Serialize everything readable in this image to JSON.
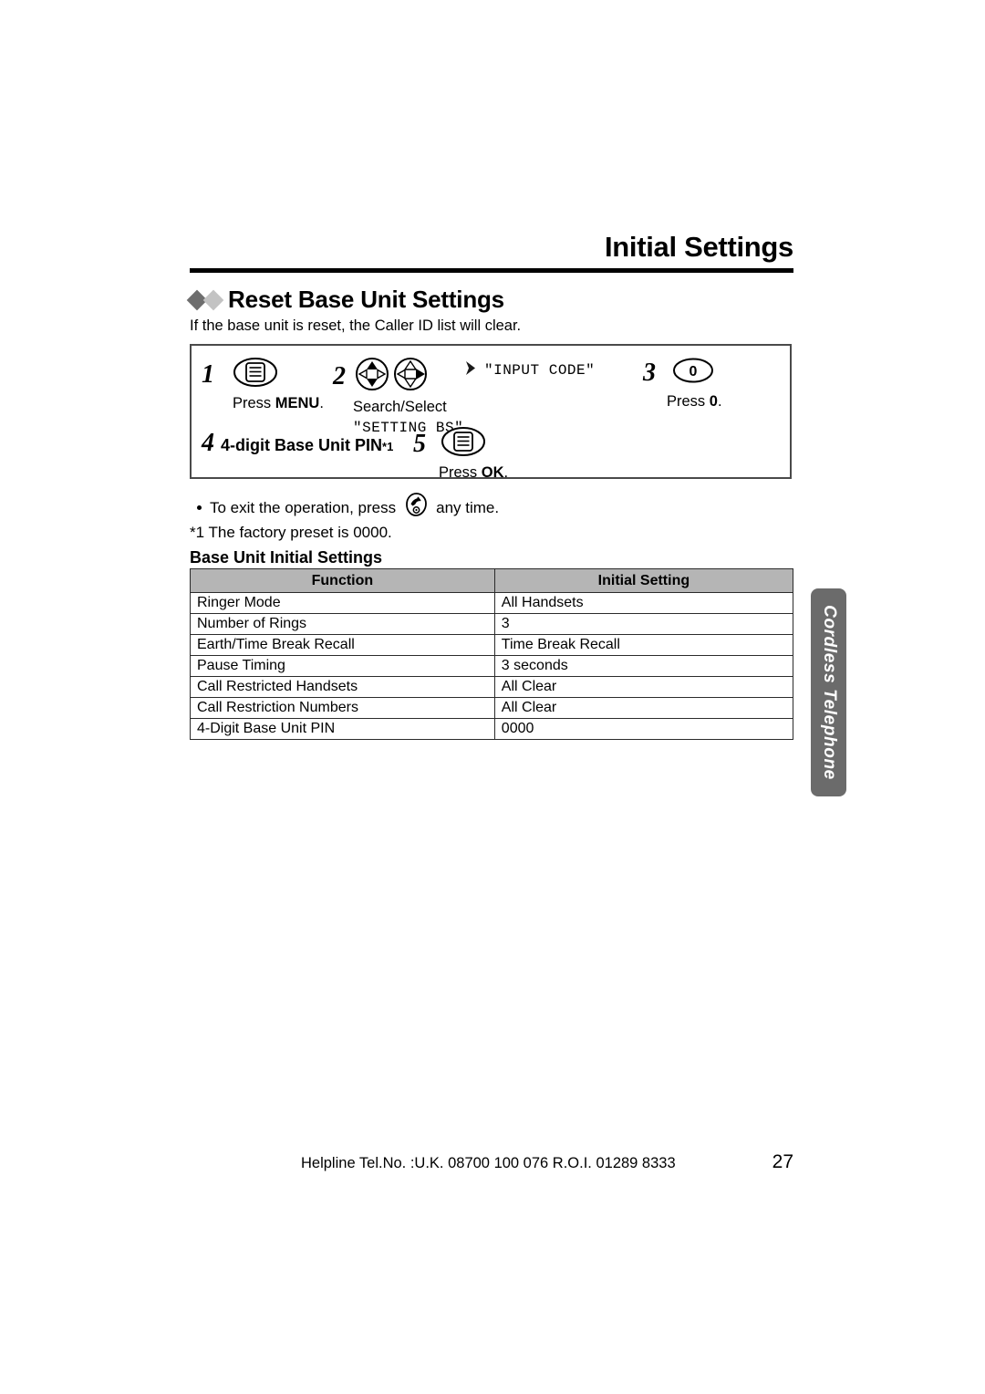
{
  "header": {
    "chapter_title": "Initial Settings"
  },
  "section": {
    "heading": "Reset Base Unit Settings",
    "intro": "If the base unit is reset, the Caller ID list will clear.",
    "bullet_dark_color": "#6e6e6e",
    "bullet_light_color": "#c3c3c3"
  },
  "steps": [
    {
      "number": "1",
      "icon": "menu-key-icon",
      "caption_prefix": "Press ",
      "caption_key": "MENU",
      "caption_suffix": "."
    },
    {
      "number": "2",
      "icon": "navigator-pad-icon",
      "caption_line1": "Search/Select",
      "caption_line2": "\"SETTING BS\".",
      "arrow_icon": "right-arrow-marker-icon",
      "lcd_display": "\"INPUT CODE\""
    },
    {
      "number": "3",
      "icon": "zero-key-icon",
      "caption_prefix": "Press ",
      "caption_key": "0",
      "caption_suffix": "."
    },
    {
      "number": "4",
      "label": "4-digit Base Unit PIN",
      "footnote_marker": "*1"
    },
    {
      "number": "5",
      "icon": "ok-key-icon",
      "caption_prefix": "Press ",
      "caption_key": "OK",
      "caption_suffix": "."
    }
  ],
  "notes": {
    "exit_prefix": "To exit the operation, press",
    "exit_icon": "offhook-key-icon",
    "exit_suffix": "any time.",
    "footnote": "*1 The factory preset is 0000."
  },
  "table": {
    "title": "Base Unit Initial Settings",
    "header_bg": "#b5b5b5",
    "columns": [
      "Function",
      "Initial Setting"
    ],
    "rows": [
      [
        "Ringer Mode",
        "All Handsets"
      ],
      [
        "Number of Rings",
        "3"
      ],
      [
        "Earth/Time Break Recall",
        "Time Break Recall"
      ],
      [
        "Pause Timing",
        "3 seconds"
      ],
      [
        "Call Restricted Handsets",
        "All Clear"
      ],
      [
        "Call Restriction Numbers",
        "All Clear"
      ],
      [
        "4-Digit Base Unit PIN",
        "0000"
      ]
    ]
  },
  "side_tab": {
    "label": "Cordless Telephone",
    "bg_color": "#6b6b6b",
    "text_color": "#ffffff"
  },
  "footer": {
    "helpline": "Helpline Tel.No. :U.K. 08700 100 076  R.O.I. 01289 8333",
    "page_number": "27"
  }
}
